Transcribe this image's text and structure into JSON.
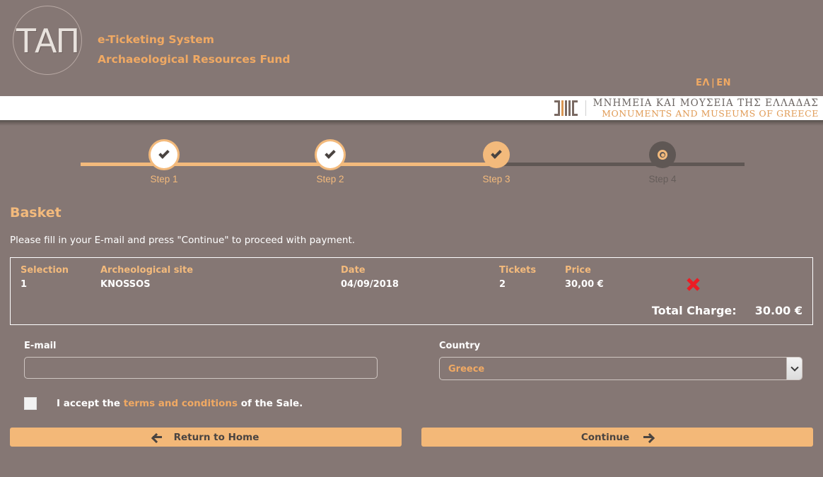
{
  "brand": {
    "logo_mark": "ΤΑΠ",
    "line1": "e-Ticketing System",
    "line2": "Archaeological Resources Fund"
  },
  "lang": {
    "el": "ΕΛ",
    "separator": "|",
    "en": "EN"
  },
  "band": {
    "greek": "ΜΝΗΜΕΙΑ ΚΑΙ ΜΟΥΣΕΙΑ ΤΗΣ ΕΛΛΑΔΑΣ",
    "english": "MONUMENTS AND MUSEUMS OF GREECE"
  },
  "stepper": {
    "steps": [
      {
        "label": "Step 1",
        "state": "done"
      },
      {
        "label": "Step 2",
        "state": "done"
      },
      {
        "label": "Step 3",
        "state": "current"
      },
      {
        "label": "Step 4",
        "state": "todo"
      }
    ]
  },
  "page": {
    "title": "Basket",
    "subtitle": "Please fill in your E-mail and press \"Continue\" to proceed with payment."
  },
  "basket": {
    "headers": {
      "selection": "Selection",
      "site": "Archeological site",
      "date": "Date",
      "tickets": "Tickets",
      "price": "Price"
    },
    "rows": [
      {
        "selection": "1",
        "site": "KNOSSOS",
        "date": "04/09/2018",
        "tickets": "2",
        "price": "30,00 €"
      }
    ],
    "total_label": "Total Charge:",
    "total_value": "30.00  €"
  },
  "form": {
    "email_label": "E-mail",
    "email_value": "",
    "email_placeholder": "",
    "country_label": "Country",
    "country_value": "Greece",
    "country_options": [
      "Greece"
    ]
  },
  "terms": {
    "checked": false,
    "prefix": "I accept the",
    "link": "terms and conditions",
    "suffix": "of the Sale."
  },
  "buttons": {
    "return_home": "Return to Home",
    "continue": "Continue"
  },
  "colors": {
    "background": "#857774",
    "accent": "#f0a963",
    "accent_light": "#f3ba7c",
    "button": "#f3b878",
    "delete": "#ec1c24",
    "step_inactive": "#5f5754"
  }
}
